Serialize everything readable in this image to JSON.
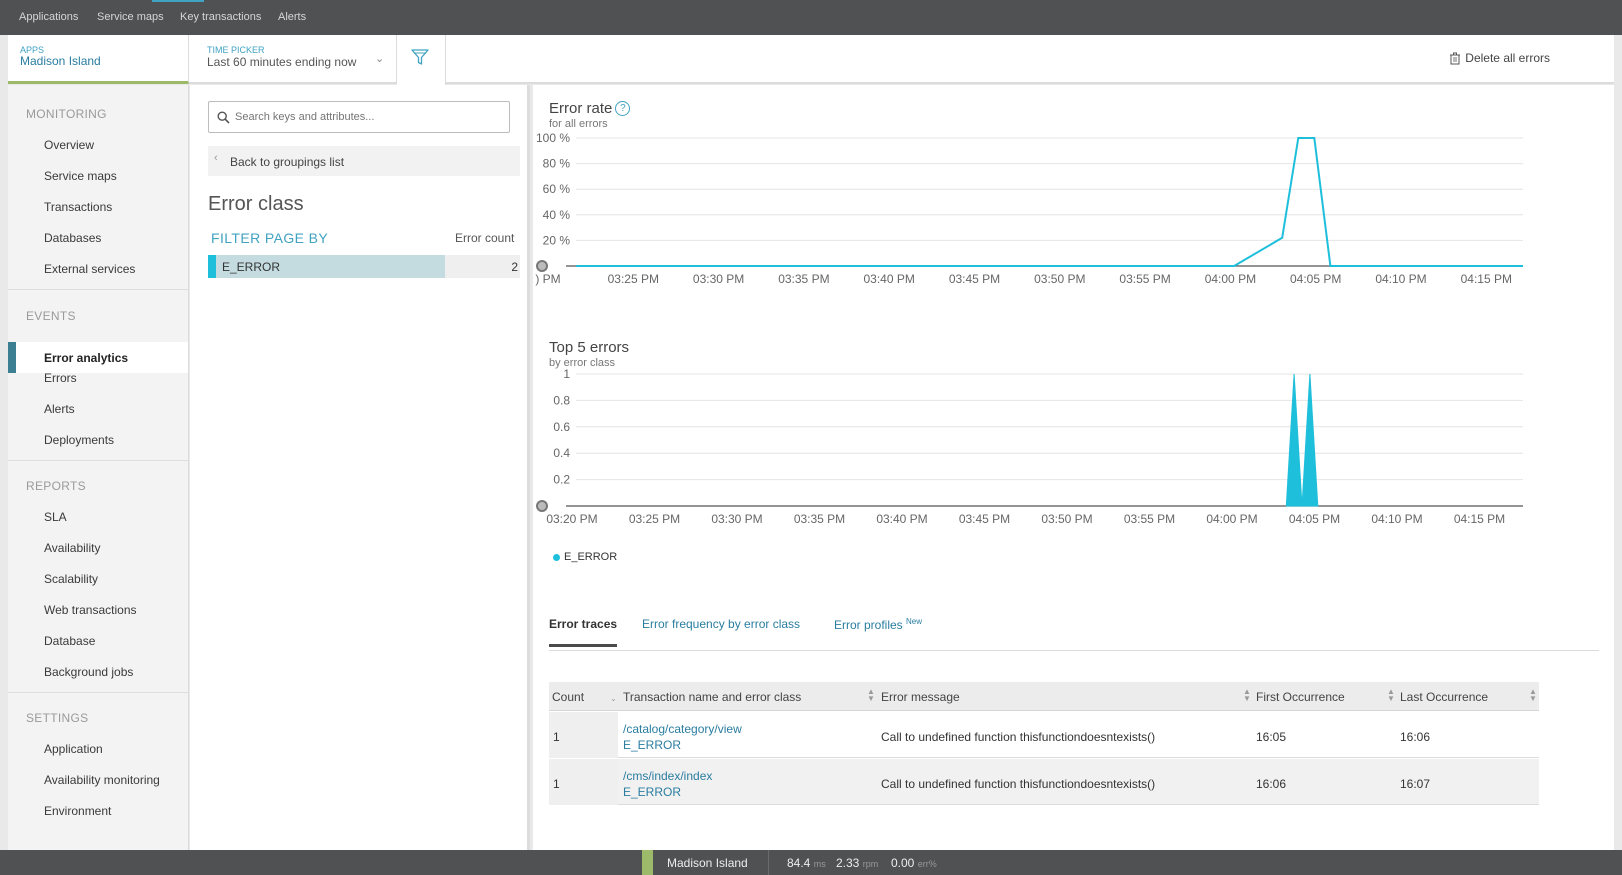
{
  "topnav": {
    "items": [
      "Applications",
      "Service maps",
      "Key transactions",
      "Alerts"
    ]
  },
  "header": {
    "apps_label": "APPS",
    "app_name": "Madison Island",
    "time_label": "TIME PICKER",
    "time_value": "Last 60 minutes ending now",
    "delete_all": "Delete all errors"
  },
  "sidebar": {
    "sections": {
      "monitoring": "MONITORING",
      "events": "EVENTS",
      "reports": "REPORTS",
      "settings": "SETTINGS"
    },
    "monitoring": [
      "Overview",
      "Service maps",
      "Transactions",
      "Databases",
      "External services"
    ],
    "events": [
      "Error analytics",
      "Errors",
      "Alerts",
      "Deployments"
    ],
    "reports": [
      "SLA",
      "Availability",
      "Scalability",
      "Web transactions",
      "Database",
      "Background jobs"
    ],
    "settings": [
      "Application",
      "Availability monitoring",
      "Environment"
    ]
  },
  "filter": {
    "search_placeholder": "Search keys and attributes...",
    "back": "Back to groupings list",
    "title": "Error class",
    "filter_by": "FILTER PAGE BY",
    "count_header": "Error count",
    "rows": [
      {
        "name": "E_ERROR",
        "count": "2"
      }
    ]
  },
  "charts": {
    "error_rate": {
      "title": "Error rate",
      "subtitle": "for all errors"
    },
    "top5": {
      "title": "Top 5 errors",
      "subtitle": "by error class",
      "legend": "E_ERROR"
    }
  },
  "chart_data": [
    {
      "type": "line",
      "title": "Error rate",
      "subtitle": "for all errors",
      "y_ticks": [
        "100 %",
        "80 %",
        "60 %",
        "40 %",
        "20 %"
      ],
      "x_ticks": [
        ") PM",
        "03:25 PM",
        "03:30 PM",
        "03:35 PM",
        "03:40 PM",
        "03:45 PM",
        "03:50 PM",
        "03:55 PM",
        "04:00 PM",
        "04:05 PM",
        "04:10 PM",
        "04:15 PM"
      ],
      "ylim": [
        0,
        100
      ],
      "xlim": [
        "15:21",
        "16:20"
      ],
      "series": [
        {
          "color": "#1ebfdb",
          "points": [
            [
              "15:21",
              0
            ],
            [
              "16:01",
              0
            ],
            [
              "16:02",
              0
            ],
            [
              "16:05",
              22
            ],
            [
              "16:06",
              100
            ],
            [
              "16:07",
              100
            ],
            [
              "16:08",
              0
            ],
            [
              "16:20",
              0
            ]
          ]
        }
      ]
    },
    {
      "type": "area",
      "title": "Top 5 errors",
      "subtitle": "by error class",
      "y_ticks": [
        "1",
        "0.8",
        "0.6",
        "0.4",
        "0.2"
      ],
      "x_ticks": [
        "03:20 PM",
        "03:25 PM",
        "03:30 PM",
        "03:35 PM",
        "03:40 PM",
        "03:45 PM",
        "03:50 PM",
        "03:55 PM",
        "04:00 PM",
        "04:05 PM",
        "04:10 PM",
        "04:15 PM"
      ],
      "ylim": [
        0,
        1
      ],
      "xlim": [
        "15:20",
        "16:20"
      ],
      "series": [
        {
          "name": "E_ERROR",
          "color": "#1ebfdb",
          "points": [
            [
              "16:05",
              0
            ],
            [
              "16:05.5",
              1
            ],
            [
              "16:06",
              0
            ],
            [
              "16:06.5",
              1
            ],
            [
              "16:07",
              0
            ]
          ]
        }
      ]
    }
  ],
  "tabs": [
    "Error traces",
    "Error frequency by error class",
    "Error profiles"
  ],
  "tab_badge": "New",
  "table": {
    "headers": [
      "Count",
      "Transaction name and error class",
      "Error message",
      "First Occurrence",
      "Last Occurrence"
    ],
    "rows": [
      {
        "count": "1",
        "txn": "/catalog/category/view",
        "cls": "E_ERROR",
        "msg": "Call to undefined function thisfunctiondoesntexists()",
        "first": "16:05",
        "last": "16:06"
      },
      {
        "count": "1",
        "txn": "/cms/index/index",
        "cls": "E_ERROR",
        "msg": "Call to undefined function thisfunctiondoesntexists()",
        "first": "16:06",
        "last": "16:07"
      }
    ]
  },
  "bottombar": {
    "app": "Madison Island",
    "ms": "84.4",
    "ms_unit": "ms",
    "rpm": "2.33",
    "rpm_unit": "rpm",
    "err": "0.00",
    "err_unit": "err%"
  },
  "colors": {
    "accent": "#1ebfdb",
    "link": "#2a7da0",
    "app_green": "#9cba6a",
    "topbar": "#4f5152"
  }
}
